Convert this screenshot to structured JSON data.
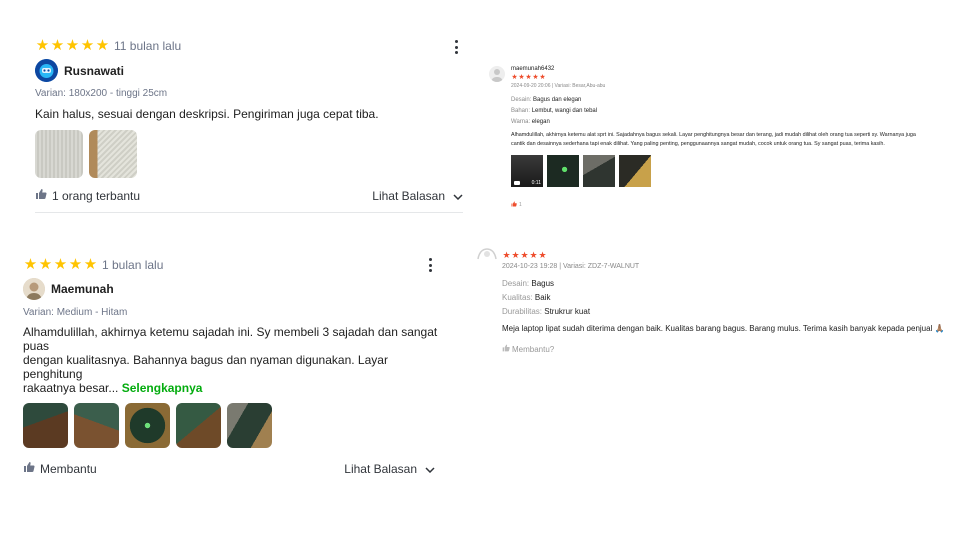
{
  "colors": {
    "star": "#FFC400",
    "star_shopee": "#EE4D2D",
    "link_green": "#03AC0E",
    "muted": "#6D7588",
    "text": "#212121"
  },
  "review1": {
    "rating": 5,
    "time": "11 bulan lalu",
    "user": "Rusnawati",
    "avatar_icon": "robot-avatar-icon",
    "variant": "Varian: 180x200 - tinggi 25cm",
    "text": "Kain halus, sesuai dengan deskripsi. Pengiriman juga cepat tiba.",
    "photo_count": 2,
    "helpful": "1 orang terbantu",
    "replies": "Lihat Balasan"
  },
  "review2": {
    "rating": 5,
    "time": "1 bulan lalu",
    "user": "Maemunah",
    "variant": "Varian: Medium - Hitam",
    "text_line1": "Alhamdulillah, akhirnya ketemu sajadah ini. Sy membeli 3 sajadah dan sangat puas",
    "text_line2": "dengan kualitasnya. Bahannya bagus dan nyaman digunakan. Layar penghitung",
    "text_line3": "rakaatnya besar... ",
    "read_more": "Selengkapnya",
    "photo_count": 5,
    "helpful": "Membantu",
    "replies": "Lihat Balasan"
  },
  "review3": {
    "user": "maemunah6432",
    "rating": 5,
    "meta": "2024-09-20 20:06 | Variasi: Besar,Abu-abu",
    "attrs": [
      {
        "label": "Desain:",
        "value": "Bagus dan elegan"
      },
      {
        "label": "Bahan:",
        "value": "Lembut, wangi dan tebal"
      },
      {
        "label": "Warna:",
        "value": "elegan"
      }
    ],
    "text_line1": "Alhamdulillah, akhirnya ketemu alat sprt ini. Sajadahnya bagus sekali. Layar penghitungnya besar dan terang, jadi mudah dilihat oleh orang tua seperti sy. Warnanya juga",
    "text_line2": "cantik dan desainnya sederhana tapi enak dilihat. Yang paling penting, penggunaannya sangat mudah, cocok untuk orang tua. Sy sangat puas, terima kasih.",
    "video_duration": "0:11",
    "likes": "1"
  },
  "review4": {
    "rating": 5,
    "meta": "2024-10-23 19:28 | Variasi: ZDZ-7-WALNUT",
    "attrs": [
      {
        "label": "Desain:",
        "value": "Bagus"
      },
      {
        "label": "Kualitas:",
        "value": "Baik"
      },
      {
        "label": "Durabilitas:",
        "value": "Strukrur kuat"
      }
    ],
    "text": "Meja laptop lipat sudah diterima dengan baik. Kualitas barang bagus. Barang mulus. Terima kasih banyak kepada penjual 🙏🏽",
    "helpful": "Membantu?"
  }
}
